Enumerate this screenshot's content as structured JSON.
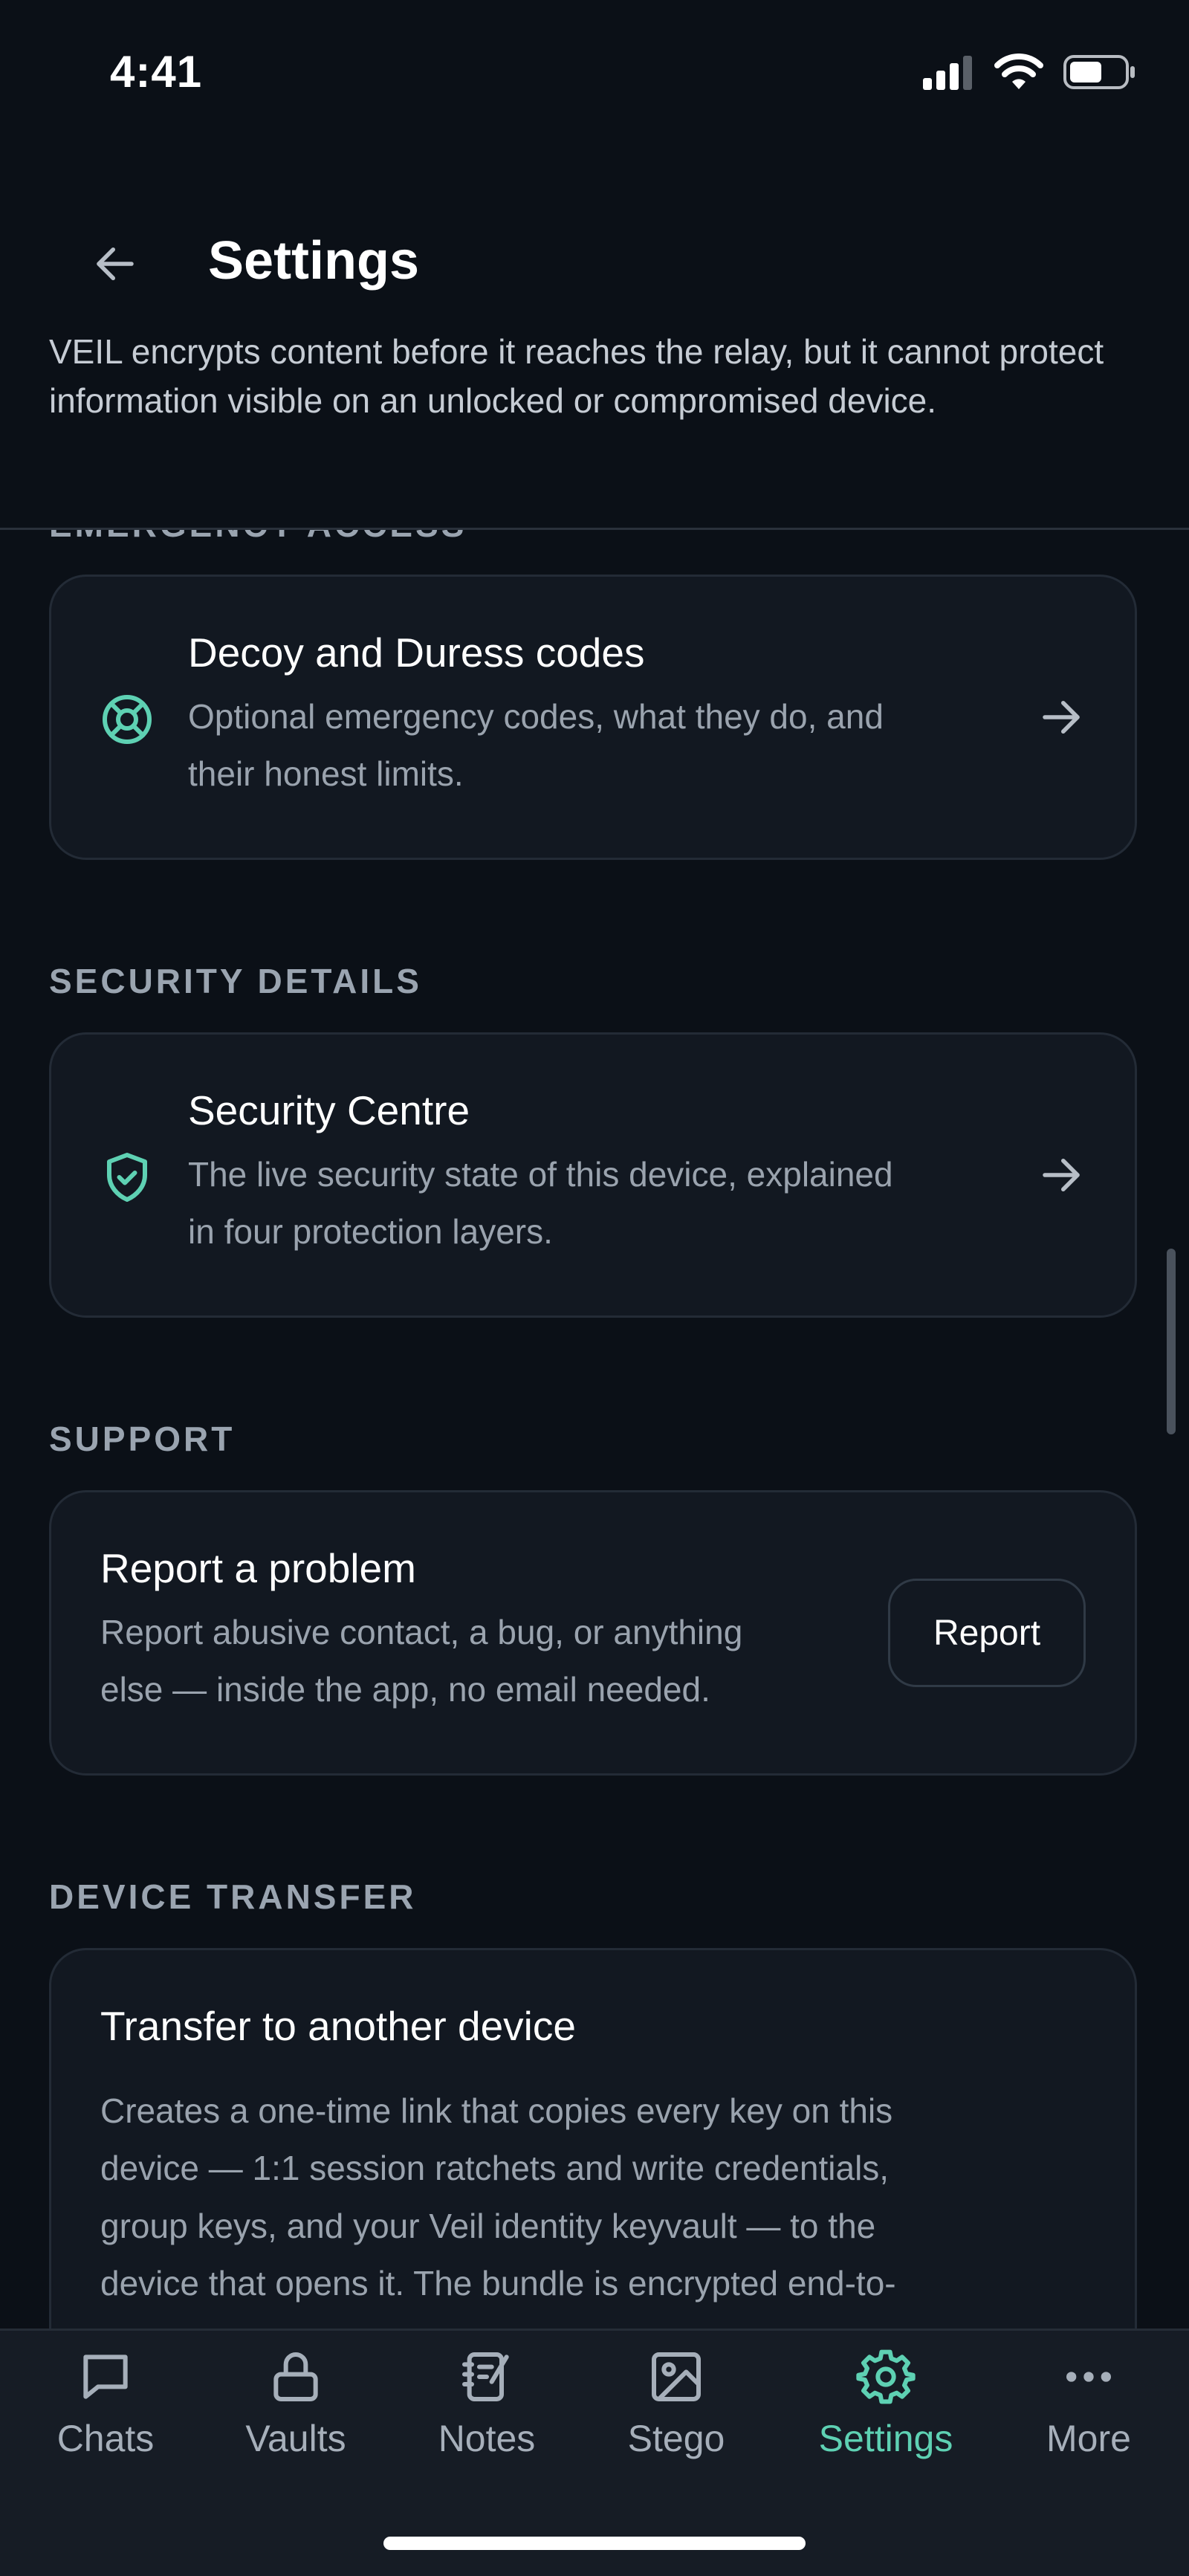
{
  "status_bar": {
    "time": "4:41"
  },
  "header": {
    "title": "Settings"
  },
  "intro_text": "VEIL encrypts content before it reaches the relay, but it cannot protect information visible on an unlocked or compromised device.",
  "sections": {
    "emergency": {
      "label": "EMERGENCY ACCESS",
      "title": "Decoy and Duress codes",
      "desc_line1": "Optional emergency codes, what they do, and",
      "desc_line2": "their honest limits.",
      "icon": "lifebuoy-icon"
    },
    "security": {
      "label": "SECURITY DETAILS",
      "title": "Security Centre",
      "desc_line1": "The live security state of this device, explained",
      "desc_line2": "in four protection layers.",
      "icon": "shield-check-icon"
    },
    "support": {
      "label": "SUPPORT",
      "title": "Report a problem",
      "desc_line1": "Report abusive contact, a bug, or anything",
      "desc_line2": "else — inside the app, no email needed.",
      "button": "Report"
    },
    "transfer": {
      "label": "DEVICE TRANSFER",
      "title": "Transfer to another device",
      "desc_lines": [
        "Creates a one-time link that copies every key on this",
        "device — 1:1 session ratchets and write credentials,",
        "group keys, and your Veil identity keyvault — to the",
        "device that opens it. The bundle is encrypted end-to-"
      ]
    }
  },
  "tabs": [
    {
      "label": "Chats",
      "icon": "chat-icon",
      "active": false
    },
    {
      "label": "Vaults",
      "icon": "lock-icon",
      "active": false
    },
    {
      "label": "Notes",
      "icon": "notebook-icon",
      "active": false
    },
    {
      "label": "Stego",
      "icon": "image-icon",
      "active": false
    },
    {
      "label": "Settings",
      "icon": "gear-icon",
      "active": true
    },
    {
      "label": "More",
      "icon": "more-icon",
      "active": false
    }
  ],
  "colors": {
    "accent": "#5ed1b3",
    "background": "#0b1017",
    "card": "#121821"
  }
}
